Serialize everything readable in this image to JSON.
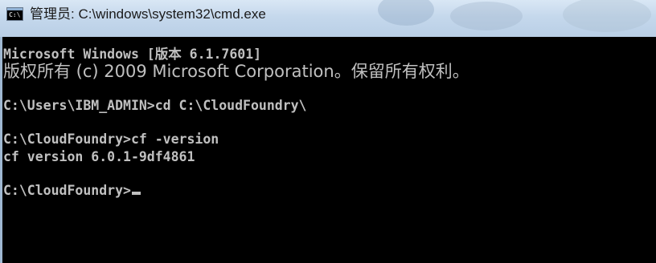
{
  "window": {
    "title": "管理员: C:\\windows\\system32\\cmd.exe",
    "icon_label": "C:\\"
  },
  "console": {
    "line1": "Microsoft Windows [版本 6.1.7601]",
    "line2": "版权所有 (c) 2009 Microsoft Corporation。保留所有权利。",
    "line3": "C:\\Users\\IBM_ADMIN>cd C:\\CloudFoundry\\",
    "line4": "C:\\CloudFoundry>cf -version",
    "line5": "cf version 6.0.1-9df4861",
    "line6": "C:\\CloudFoundry>"
  },
  "colors": {
    "console_background": "#000000",
    "console_text": "#c0c0c0",
    "titlebar": "#c5d8ec"
  }
}
